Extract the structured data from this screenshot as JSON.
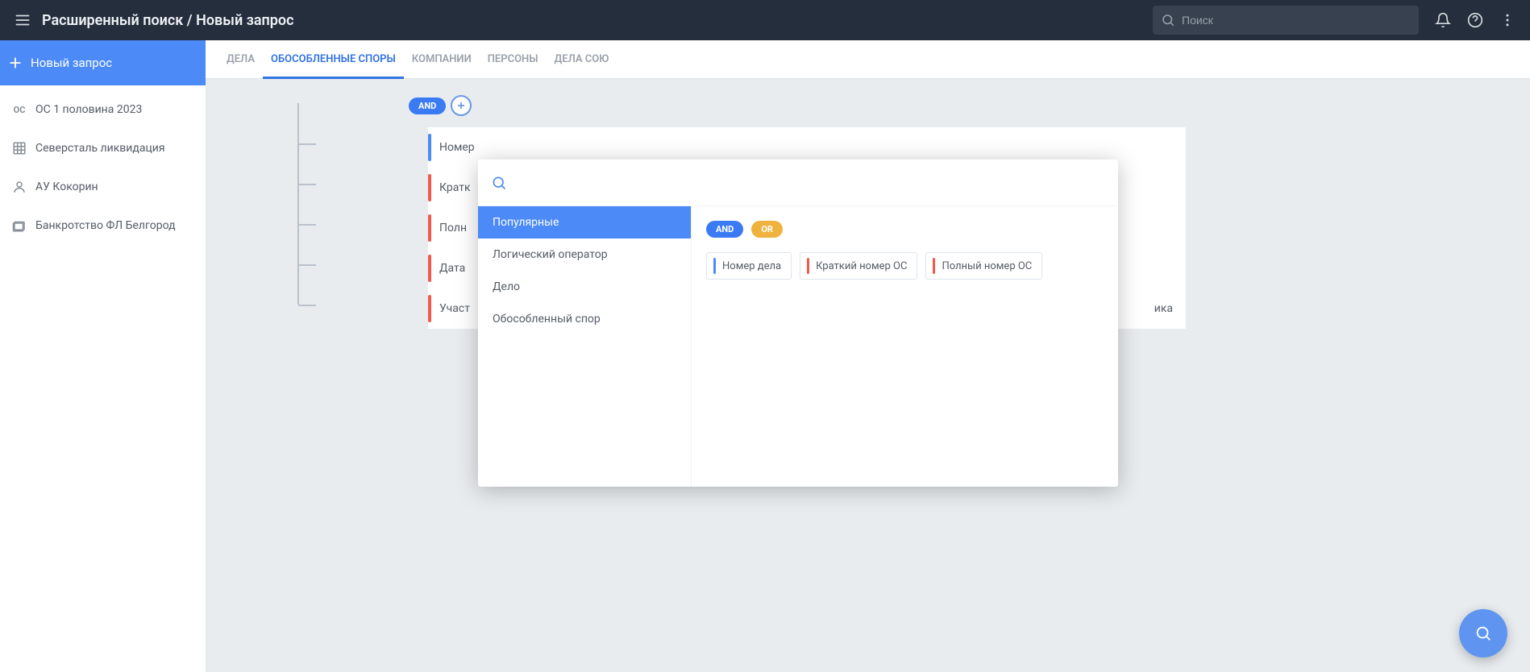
{
  "header": {
    "title": "Расширенный поиск / Новый запрос",
    "search_placeholder": "Поиск"
  },
  "sidebar": {
    "new_query_label": "Новый запрос",
    "items": [
      {
        "icon": "oc",
        "label": "ОС 1 половина 2023"
      },
      {
        "icon": "company",
        "label": "Северсталь ликвидация"
      },
      {
        "icon": "person",
        "label": "АУ Кокорин"
      },
      {
        "icon": "folder",
        "label": "Банкротство ФЛ Белгород"
      }
    ]
  },
  "tabs": [
    {
      "label": "Дела",
      "active": false
    },
    {
      "label": "Обособленные споры",
      "active": true
    },
    {
      "label": "Компании",
      "active": false
    },
    {
      "label": "Персоны",
      "active": false
    },
    {
      "label": "Дела СОЮ",
      "active": false
    }
  ],
  "operator_label": "AND",
  "conditions": [
    {
      "marker": "blue",
      "label": "Номер"
    },
    {
      "marker": "red",
      "label": "Кратк"
    },
    {
      "marker": "red",
      "label": "Полн"
    },
    {
      "marker": "red",
      "label": "Дата"
    },
    {
      "marker": "red",
      "label": "Участ"
    }
  ],
  "trailing_text": "ика",
  "popup": {
    "categories": [
      {
        "label": "Популярные",
        "active": true
      },
      {
        "label": "Логический оператор",
        "active": false
      },
      {
        "label": "Дело",
        "active": false
      },
      {
        "label": "Обособленный спор",
        "active": false
      }
    ],
    "operators": {
      "and": "AND",
      "or": "OR"
    },
    "fields": [
      {
        "marker": "blue",
        "label": "Номер дела"
      },
      {
        "marker": "red",
        "label": "Краткий номер ОС"
      },
      {
        "marker": "red",
        "label": "Полный номер ОС"
      }
    ]
  },
  "colors": {
    "primary": "#4b8af7",
    "header_bg": "#242e3c",
    "marker_red": "#f15a4a",
    "or_pill": "#f0b23e"
  }
}
